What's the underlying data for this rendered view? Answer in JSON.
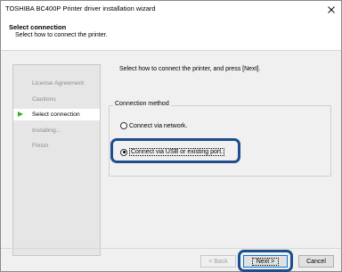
{
  "window": {
    "title": "TOSHIBA BC400P Printer driver installation wizard"
  },
  "header": {
    "title": "Select connection",
    "subtitle": "Select how to connect the printer."
  },
  "steps": [
    {
      "label": "License Agreement",
      "active": false
    },
    {
      "label": "Cautions",
      "active": false
    },
    {
      "label": "Select connection",
      "active": true
    },
    {
      "label": "Installing...",
      "active": false
    },
    {
      "label": "Finish",
      "active": false
    }
  ],
  "main": {
    "instruction": "Select how to connect the printer, and press [Next].",
    "group_label": "Connection method",
    "options": [
      {
        "label": "Connect via network.",
        "selected": false
      },
      {
        "label": "Connect via USB or existing port.",
        "selected": true
      }
    ]
  },
  "buttons": {
    "back": "< Back",
    "next": "Next >",
    "cancel": "Cancel"
  },
  "colors": {
    "highlight": "#1e4c8c",
    "step_arrow": "#31b31f"
  }
}
